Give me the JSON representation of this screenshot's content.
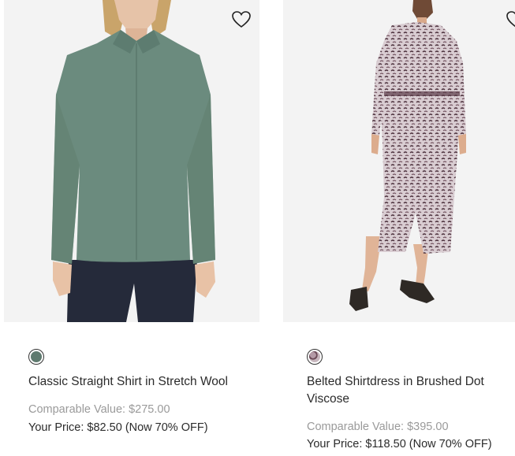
{
  "products": [
    {
      "name": "Classic Straight Shirt in Stretch Wool",
      "comparable_label": "Comparable Value:",
      "comparable_price": "$275.00",
      "your_price_label": "Your Price:",
      "your_price": "$82.50",
      "discount": "(Now 70% OFF)",
      "swatch_color": "#5f7a6f",
      "wishlist_icon": "heart-outline-icon"
    },
    {
      "name": "Belted Shirtdress in Brushed Dot Viscose",
      "comparable_label": "Comparable Value:",
      "comparable_price": "$395.00",
      "your_price_label": "Your Price:",
      "your_price": "$118.50",
      "discount": "(Now 70% OFF)",
      "swatch_color": "#8a6f78",
      "wishlist_icon": "heart-outline-icon"
    }
  ]
}
